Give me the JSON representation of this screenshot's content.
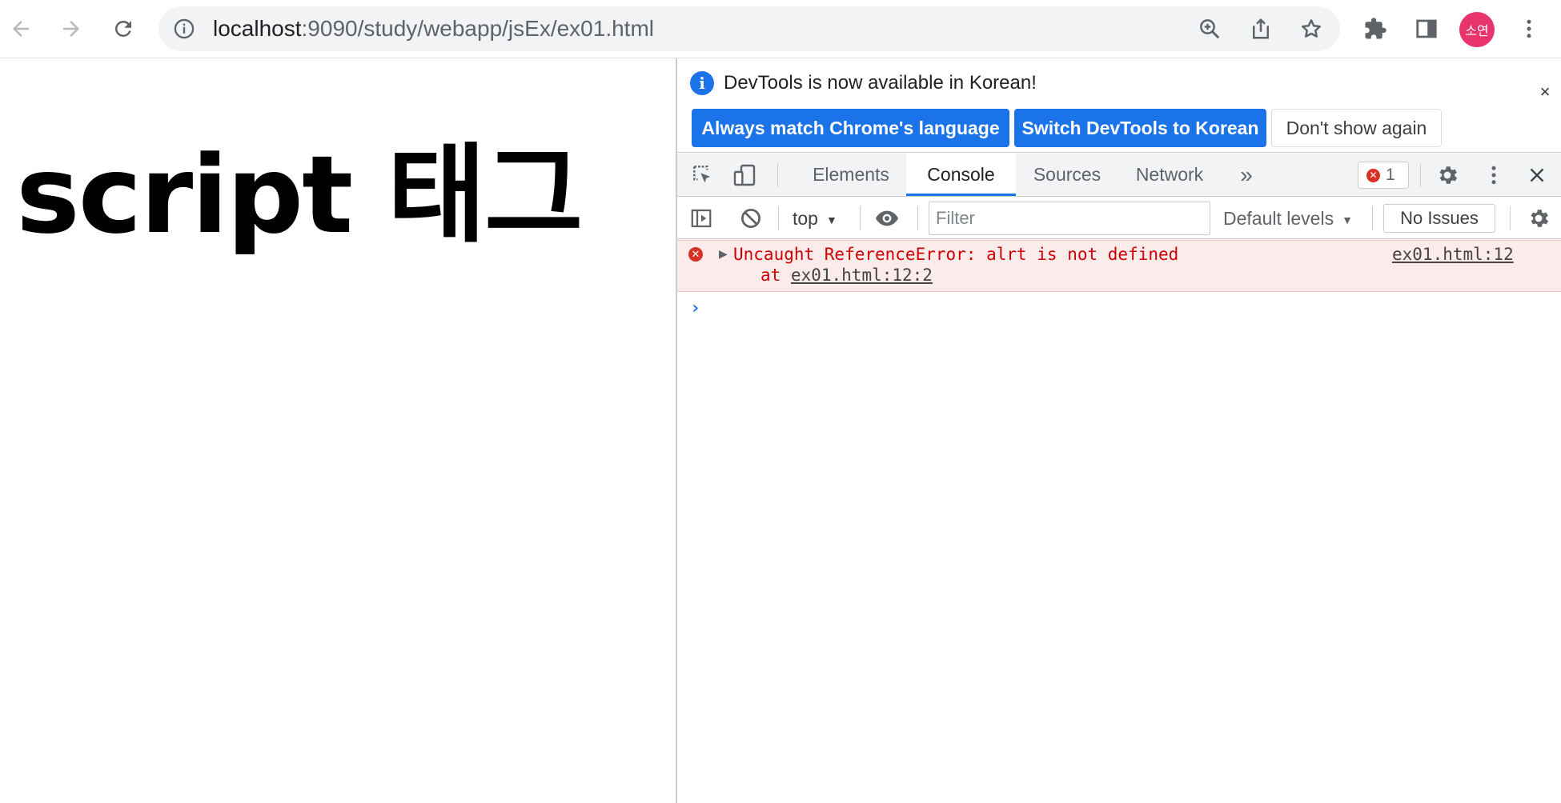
{
  "browser": {
    "url_host": "localhost",
    "url_path": ":9090/study/webapp/jsEx/ex01.html",
    "profile_initials": "소연",
    "icons": [
      "back-arrow-icon",
      "forward-arrow-icon",
      "reload-icon",
      "info-icon",
      "zoom-icon",
      "share-icon",
      "star-icon",
      "extensions-puzzle-icon",
      "side-panel-icon",
      "kebab-menu-icon"
    ],
    "colors": {
      "avatar": "#e8336d",
      "omnibox": "#f1f3f4"
    }
  },
  "page": {
    "heading": "script 태그"
  },
  "devtools": {
    "infobar": {
      "message": "DevTools is now available in Korean!",
      "btn_match": "Always match Chrome's language",
      "btn_switch": "Switch DevTools to Korean",
      "btn_dont": "Don't show again",
      "close": "×"
    },
    "tabs": {
      "elements": "Elements",
      "console": "Console",
      "sources": "Sources",
      "network": "Network",
      "more": "»",
      "active": "Console"
    },
    "error_count": "1",
    "console_toolbar": {
      "context": "top",
      "filter_placeholder": "Filter",
      "levels": "Default levels",
      "issues": "No Issues"
    },
    "error": {
      "message": "Uncaught ReferenceError: alrt is not defined",
      "stack_prefix": "at ",
      "stack_link": "ex01.html:12:2",
      "source": "ex01.html:12"
    },
    "prompt": "›",
    "colors": {
      "accent": "#1a73e8",
      "error": "#d93025",
      "error_bg": "#fcebeb"
    }
  }
}
